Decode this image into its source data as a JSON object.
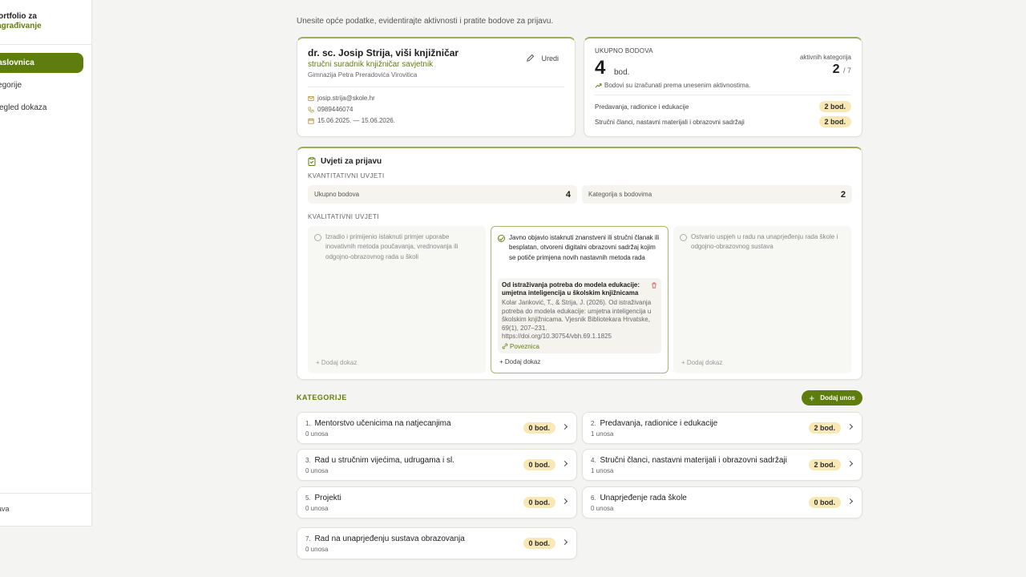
{
  "sidebar": {
    "brand_line1": "portfolio za",
    "brand_line2": "nagrađivanje",
    "items": [
      {
        "label": "Naslovnica",
        "active": true
      },
      {
        "label": "Kategorije",
        "active": false
      },
      {
        "label": "Pregled dokaza",
        "active": false
      }
    ],
    "footer": "Odjava"
  },
  "header": {
    "subtitle": "Unesite opće podatke, evidentirajte aktivnosti i pratite bodove za prijavu."
  },
  "profile": {
    "name": "dr. sc. Josip Strija, viši knjižničar",
    "role": "stručni suradnik knjižničar savjetnik",
    "school": "Gimnazija Petra Preradovića Virovitica",
    "edit_label": "Uredi",
    "email": "josip.strija@skole.hr",
    "phone": "0989446074",
    "period": "15.06.2025. — 15.06.2026."
  },
  "score": {
    "label": "UKUPNO BODOVA",
    "total": "4",
    "unit": "bod.",
    "active_label": "aktivnih kategorija",
    "active_count": "2",
    "active_total": "/ 7",
    "note": "Bodovi su izračunati prema unesenim aktivnostima.",
    "rows": [
      {
        "label": "Predavanja, radionice i edukacije",
        "points": "2 bod."
      },
      {
        "label": "Stručni članci, nastavni materijali i obrazovni sadržaji",
        "points": "2 bod."
      }
    ]
  },
  "conditions": {
    "title": "Uvjeti za prijavu",
    "quant_label": "KVANTITATIVNI UVJETI",
    "quant": [
      {
        "label": "Ukupno bodova",
        "value": "4"
      },
      {
        "label": "Kategorija s bodovima",
        "value": "2"
      }
    ],
    "qual_label": "KVALITATIVNI UVJETI",
    "qual": [
      {
        "text": "Izradio i primijenio istaknuti primjer uporabe inovativnih metoda poučavanja, vrednovanja ili odgojno-obrazovnog rada u školi",
        "checked": false,
        "add_label": "+ Dodaj dokaz"
      },
      {
        "text": "Javno objavio istaknuti znanstveni ili stručni članak ili besplatan, otvoreni digitalni obrazovni sadržaj kojim se potiče primjena novih nastavnih metoda rada",
        "checked": true,
        "add_label": "+ Dodaj dokaz",
        "evidence": {
          "title": "Od istraživanja potreba do modela edukacije: umjetna inteligencija u školskim knjižnicama",
          "citation": "Kolar Janković, T., & Strija, J. (2026). Od istraživanja potreba do modela edukacije: umjetna inteligencija u školskim knjižnicama. Vjesnik Bibliotekara Hrvatske, 69(1), 207–231. https://doi.org/10.30754/vbh.69.1.1825",
          "link_label": "Poveznica"
        }
      },
      {
        "text": "Ostvario uspjeh u radu na unaprjeđenju rada škole i odgojno-obrazovnog sustava",
        "checked": false,
        "add_label": "+ Dodaj dokaz"
      }
    ]
  },
  "categories": {
    "title": "KATEGORIJE",
    "add_label": "Dodaj unos",
    "items": [
      {
        "num": "1.",
        "name": "Mentorstvo učenicima na natjecanjima",
        "entries": "0 unosa",
        "points": "0 bod."
      },
      {
        "num": "2.",
        "name": "Predavanja, radionice i edukacije",
        "entries": "1 unosa",
        "points": "2 bod."
      },
      {
        "num": "3.",
        "name": "Rad u stručnim vijećima, udrugama i sl.",
        "entries": "0 unosa",
        "points": "0 bod."
      },
      {
        "num": "4.",
        "name": "Stručni članci, nastavni materijali i obrazovni sadržaji",
        "entries": "1 unosa",
        "points": "2 bod."
      },
      {
        "num": "5.",
        "name": "Projekti",
        "entries": "0 unosa",
        "points": "0 bod."
      },
      {
        "num": "6.",
        "name": "Unaprjeđenje rada škole",
        "entries": "0 unosa",
        "points": "0 bod."
      },
      {
        "num": "7.",
        "name": "Rad na unaprjeđenju sustava obrazovanja",
        "entries": "0 unosa",
        "points": "0 bod."
      }
    ]
  },
  "colors": {
    "accent": "#5f7d0e",
    "pill_bg": "#f8e8b5",
    "page_bg": "#f4f4f2"
  }
}
